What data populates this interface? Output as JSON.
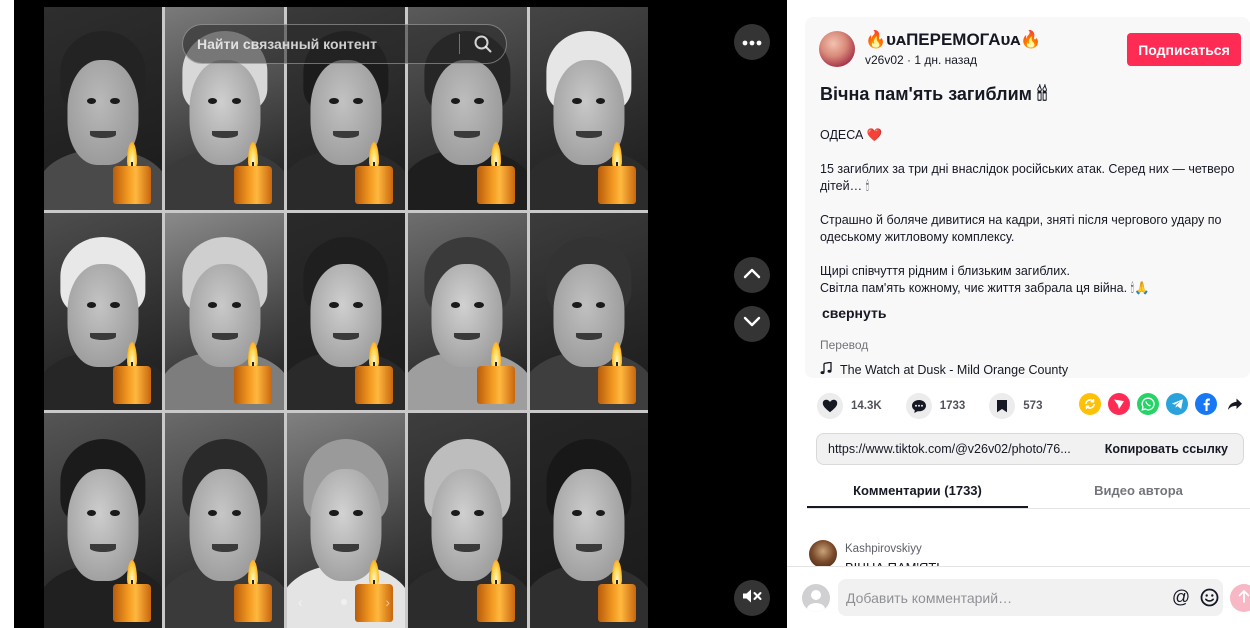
{
  "video": {
    "search_placeholder": "Найти связанный контент",
    "page_indicator": "1"
  },
  "post": {
    "author_name": "🔥ᴜᴀПЕРЕМОГАᴜᴀ🔥",
    "author_meta": "v26v02 · 1 дн. назад",
    "follow_label": "Подписаться",
    "title": "Вічна пам'ять загиблим 🕯🕯",
    "location": "ОДЕСА ❤️",
    "paragraph_1": "15 загиблих за три дні внаслідок російських атак. Серед них — четверо дітей… 🕯",
    "paragraph_2": "Страшно й боляче дивитися на кадри, зняті після чергового удару по одеському житловому комплексу.",
    "paragraph_3a": "Щирі співчуття рідним і близьким загиблих.",
    "paragraph_3b": "Світла пам'ять кожному, чиє життя забрала ця війна. 🕯🙏",
    "collapse_label": "свернуть",
    "translate_label": "Перевод",
    "music": "The Watch at Dusk - Mild Orange County"
  },
  "stats": {
    "likes": "14.3K",
    "comments": "1733",
    "saves": "573"
  },
  "share": {
    "url": "https://www.tiktok.com/@v26v02/photo/76...",
    "copy_label": "Копировать ссылку"
  },
  "tabs": {
    "comments": "Комментарии (1733)",
    "author_videos": "Видео автора"
  },
  "comments": [
    {
      "user": "Kashpirovskiyy",
      "text": "ВІЧНА ПАМ'ЯТЬ"
    }
  ],
  "comment_input": {
    "placeholder": "Добавить комментарий…"
  },
  "colors": {
    "brand": "#fe2c55",
    "media_bg": "#000000"
  }
}
